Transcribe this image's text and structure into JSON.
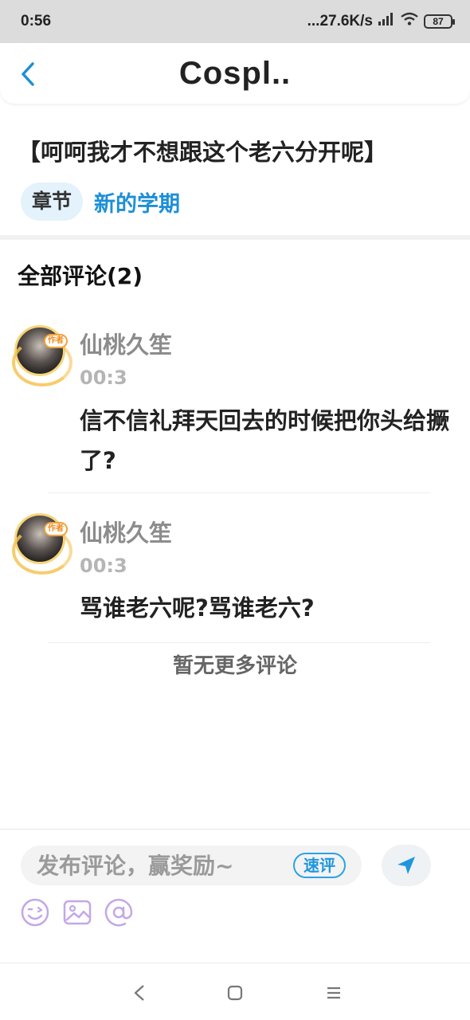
{
  "status_bar": {
    "time": "0:56",
    "network_speed": "...27.6K/s",
    "battery": "87"
  },
  "header": {
    "title": "Cospl.."
  },
  "chapter": {
    "title": "【呵呵我才不想跟这个老六分开呢】",
    "tag_label": "章节",
    "chapter_name": "新的学期"
  },
  "comments_section": {
    "header": "全部评论(2)",
    "comments": [
      {
        "user_name": "仙桃久笙",
        "time": "00:3",
        "badge": "作者",
        "text": "信不信礼拜天回去的时候把你头给撅了?"
      },
      {
        "user_name": "仙桃久笙",
        "time": "00:3",
        "badge": "作者",
        "text": "骂谁老六呢?骂谁老六?"
      }
    ],
    "no_more_text": "暂无更多评论"
  },
  "composer": {
    "placeholder": "发布评论，赢奖励~",
    "quick_comment_label": "速评"
  },
  "colors": {
    "accent_blue": "#1d8fd6",
    "tag_bg": "#e3f2fb",
    "icon_purple": "#c4a7e8"
  },
  "icons": {
    "back": "chevron-left-icon",
    "send": "send-icon",
    "emoji": "emoji-icon",
    "image": "image-icon",
    "mention": "at-icon"
  }
}
